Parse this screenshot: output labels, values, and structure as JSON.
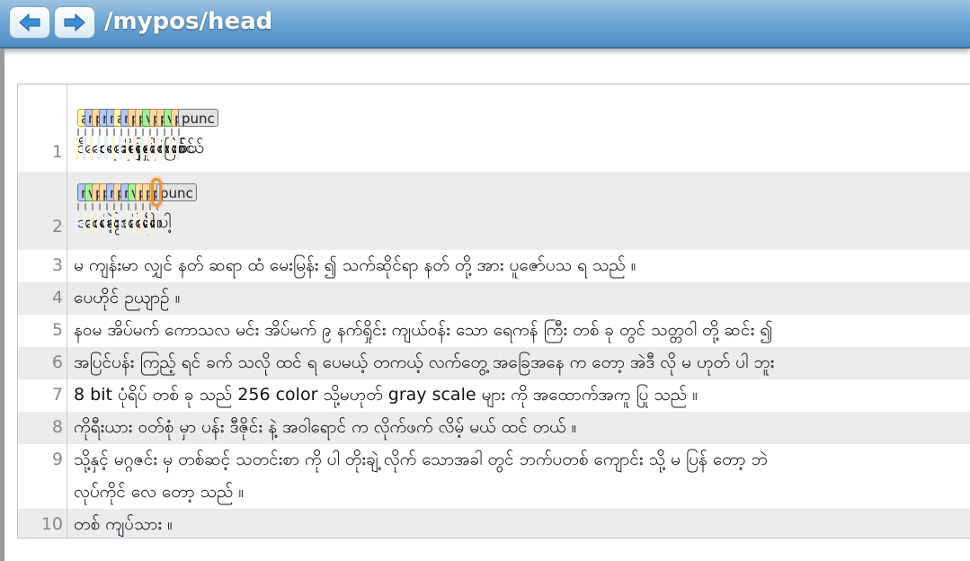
{
  "header": {
    "title": "/mypos/head",
    "back_icon": "arrow-left-icon",
    "forward_icon": "arrow-right-icon",
    "bar_color": "#5f9bd0"
  },
  "lines": [
    {
      "num": "1",
      "tokens": [
        {
          "text": "ဒီ",
          "tag": "adj"
        },
        {
          "text": "ဆေး",
          "tag": "n"
        },
        {
          "text": "က",
          "tag": "ppm"
        },
        {
          "text": "၁၀၀",
          "tag": "num"
        },
        {
          "text": "ရာခိုင်နှုန်း",
          "tag": "n"
        },
        {
          "text": "ဆေးဘက်ဝင်",
          "tag": "adj"
        },
        {
          "text": "အပင်",
          "tag": "n"
        },
        {
          "text": "များ",
          "tag": "part"
        },
        {
          "text": "မှ",
          "tag": "ppm"
        },
        {
          "text": "ဖော်စပ်",
          "tag": "v"
        },
        {
          "text": "ထား",
          "tag": "part"
        },
        {
          "text": "တာ",
          "tag": "part"
        },
        {
          "text": "ဖြစ်",
          "tag": "v"
        },
        {
          "text": "တယ်",
          "tag": "ppm"
        },
        {
          "text": "။",
          "tag": "punc"
        }
      ]
    },
    {
      "num": "2",
      "tokens": [
        {
          "text": "အသစ်",
          "tag": "n"
        },
        {
          "text": "ဝယ်",
          "tag": "v"
        },
        {
          "text": "ထား",
          "tag": "part"
        },
        {
          "text": "တဲ့",
          "tag": "part"
        },
        {
          "text": "ဆွယ်တာ",
          "tag": "n"
        },
        {
          "text": "က",
          "tag": "ppm"
        },
        {
          "text": "အသီး",
          "tag": "n"
        },
        {
          "text": "ထ",
          "tag": "v"
        },
        {
          "text": "နေ",
          "tag": "part"
        },
        {
          "text": "ပါ",
          "tag": "part"
        },
        {
          "text": "ပေါ့",
          "tag": "part"
        },
        {
          "text": "။",
          "tag": "punc",
          "highlight": true
        }
      ]
    },
    {
      "num": "3",
      "text": "မ ကျန်းမာ လျှင် နတ် ဆရာ ထံ မေးမြန်း ၍ သက်ဆိုင်ရာ နတ် တို့ အား ပူဇော်ပသ ရ သည် ။"
    },
    {
      "num": "4",
      "text": "ပေဟိုင် ဉယျာဉ် ။"
    },
    {
      "num": "5",
      "text": "နဝမ အိပ်မက် ကောသလ မင်း အိပ်မက် ၉ နက်ရှိုင်း ကျယ်ဝန်း သော ရေကန် ကြီး တစ် ခု တွင် သတ္တဝါ တို့ ဆင်း ၍"
    },
    {
      "num": "6",
      "text": "အပြင်ပန်း ကြည့် ရင် ခက် သလို ထင် ရ ပေမယ့် တကယ့် လက်တွေ့ အခြေအနေ က တော့ အဲဒီ လို မ ဟုတ် ပါ ဘူး"
    },
    {
      "num": "7",
      "text": "8 bit ပုံရိပ် တစ် ခု သည် 256 color သို့မဟုတ် gray scale များ ကို အထောက်အကူ ပြု သည် ။"
    },
    {
      "num": "8",
      "text": "ကိုရီးယား ဝတ်စုံ မှာ ပန်း ဒီဇိုင်း နဲ့ အဝါရောင် က လိုက်ဖက် လိမ့် မယ် ထင် တယ် ။"
    },
    {
      "num": "9",
      "text": "သို့နှင့် မဂ္ဂဇင်း မှ တစ်ဆင့် သတင်းစာ ကို ပါ တိုးချဲ့ လိုက် သောအခါ တွင် ဘက်ပတစ် ကျောင်း သို့ မ ပြန် တော့ ဘဲ",
      "text2": "လုပ်ကိုင် လေ တော့ သည် ။"
    },
    {
      "num": "10",
      "text": "တစ် ကျပ်သား ။"
    }
  ]
}
